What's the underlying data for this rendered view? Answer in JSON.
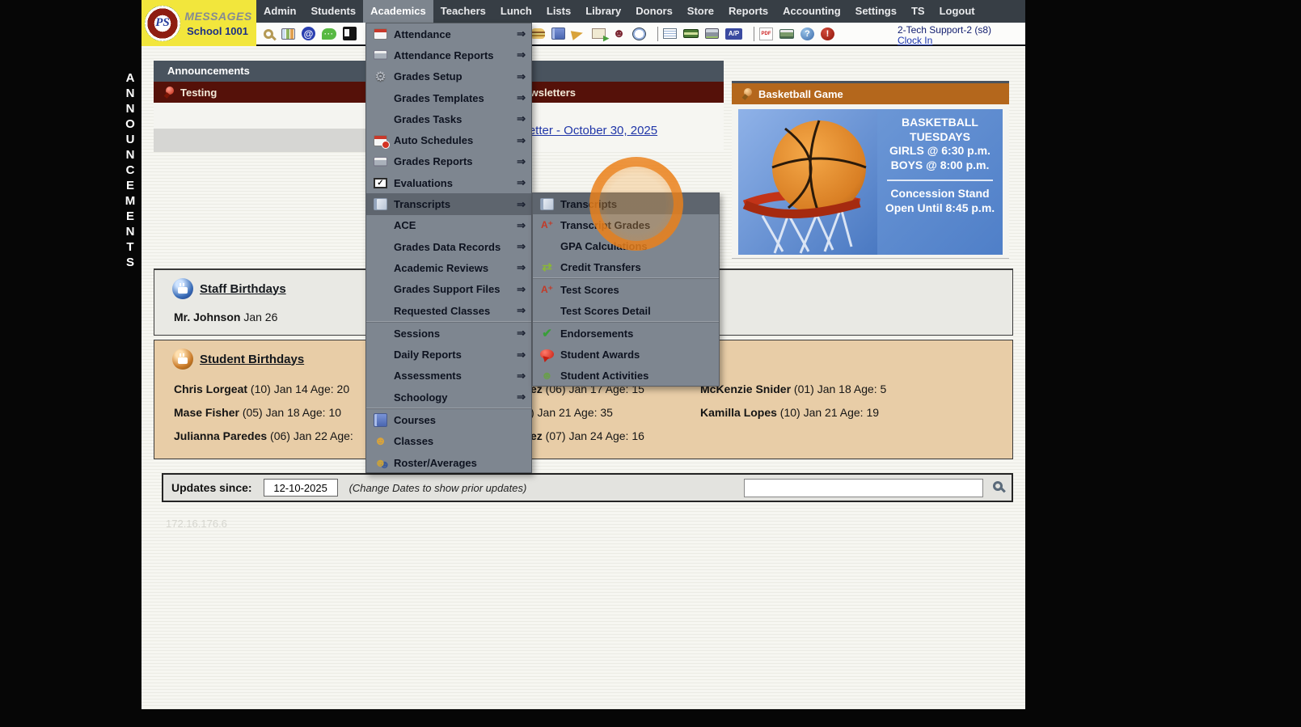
{
  "brand": {
    "name": "MESSAGES",
    "school": "School 1001",
    "monogram": "PS"
  },
  "nav": {
    "items": [
      "Admin",
      "Students",
      "Academics",
      "Teachers",
      "Lunch",
      "Lists",
      "Library",
      "Donors",
      "Store",
      "Reports",
      "Accounting",
      "Settings",
      "TS",
      "Logout"
    ],
    "active": "Academics"
  },
  "toolbar": {
    "user_label": "2-Tech Support-2 (s8)",
    "clock_in": "Clock In",
    "icons": [
      {
        "name": "search-icon",
        "cls": "i-search",
        "lens": true
      },
      {
        "name": "calendar-icon",
        "cls": "i-cal"
      },
      {
        "name": "email-icon",
        "cls": "i-at",
        "ch": "@"
      },
      {
        "name": "chat-icon",
        "cls": "i-chat",
        "ch": "···"
      },
      {
        "name": "mobile-icon",
        "cls": "i-mobile"
      },
      {
        "name": "speaker-icon",
        "cls": "i-speaker",
        "ch": "◀"
      },
      {
        "name": "toolbar-gap",
        "cls": "tb-gap",
        "deco": true
      },
      {
        "name": "lunch-icon",
        "cls": "i-lunch"
      },
      {
        "name": "binder-icon",
        "cls": "i-binder"
      },
      {
        "name": "horn-icon",
        "cls": "i-horn"
      },
      {
        "name": "send-note-icon",
        "cls": "i-send"
      },
      {
        "name": "staff-icon",
        "cls": "i-staff",
        "ch": "☻"
      },
      {
        "name": "clock-icon",
        "cls": "i-clock"
      },
      {
        "name": "toolbar-divider",
        "cls": "tb-divider",
        "deco": true
      },
      {
        "name": "spreadsheet-icon",
        "cls": "i-sheet"
      },
      {
        "name": "payment-icon",
        "cls": "i-pay"
      },
      {
        "name": "print-payment-icon",
        "cls": "i-printpay"
      },
      {
        "name": "ap-icon",
        "cls": "i-ap",
        "ch": "A/P"
      },
      {
        "name": "toolbar-divider",
        "cls": "tb-divider",
        "deco": true
      },
      {
        "name": "pdf-icon",
        "cls": "i-pdf",
        "ch": "PDF"
      },
      {
        "name": "scanner-icon",
        "cls": "i-scan"
      },
      {
        "name": "help-icon",
        "cls": "i-help",
        "ch": "?"
      },
      {
        "name": "alert-icon",
        "cls": "i-alert",
        "ch": "!"
      }
    ]
  },
  "left_rail": {
    "text": "ANNOUNCEMENTS"
  },
  "announcements": {
    "section_title": "Announcements",
    "testing": {
      "title": "Testing"
    },
    "newsletters": {
      "title": "Newsletters",
      "link": "Newsletter - October 30, 2025"
    },
    "basketball": {
      "title": "Basketball Game",
      "lines": [
        "BASKETBALL",
        "TUESDAYS",
        "GIRLS @ 6:30 p.m.",
        "BOYS  @ 8:00 p.m."
      ],
      "footer_lines": [
        "Concession Stand",
        "Open Until 8:45 p.m."
      ]
    }
  },
  "staff_birthdays": {
    "title": "Staff Birthdays",
    "entries": [
      {
        "b": "Mr. Johnson",
        "r": " Jan 26"
      }
    ]
  },
  "student_birthdays": {
    "title": "Student Birthdays",
    "columns": [
      [
        {
          "b": "Chris Lorgeat",
          "r": " (10) Jan 14 Age: 20"
        },
        {
          "b": "Mase Fisher",
          "r": " (05) Jan 18 Age: 10"
        },
        {
          "b": "Julianna Paredes",
          "r": " (06) Jan 22 Age:"
        }
      ],
      [
        {
          "b": "ez",
          "r": " (06) Jan 17 Age: 15"
        },
        {
          "b": "",
          "r": ") Jan 21 Age: 35"
        },
        {
          "b": "ez",
          "r": " (07) Jan 24 Age: 16"
        }
      ],
      [
        {
          "b": "McKenzie Snider",
          "r": " (01) Jan 18 Age: 5"
        },
        {
          "b": "Kamilla Lopes",
          "r": " (10) Jan 21 Age: 19"
        }
      ]
    ]
  },
  "updates": {
    "label": "Updates since:",
    "date": "12-10-2025",
    "hint": "(Change Dates to show prior updates)",
    "search_value": ""
  },
  "watermark": "172.16.176.6",
  "academics_menu": {
    "arrow_ch": "⇒",
    "items": [
      {
        "label": "Attendance",
        "icon": "ic-cal",
        "arrow": true
      },
      {
        "label": "Attendance Reports",
        "icon": "ic-print",
        "arrow": true
      },
      {
        "label": "Grades Setup",
        "icon": "ic-gear",
        "ch": "⚙",
        "arrow": true
      },
      {
        "label": "Grades Templates",
        "arrow": true
      },
      {
        "label": "Grades Tasks",
        "arrow": true
      },
      {
        "label": "Auto Schedules",
        "icon": "ic-calclock",
        "arrow": true
      },
      {
        "label": "Grades Reports",
        "icon": "ic-print",
        "arrow": true
      },
      {
        "label": "Evaluations",
        "icon": "ic-checkbox",
        "ch": "✓",
        "arrow": true
      },
      {
        "label": "Transcripts",
        "icon": "ic-scroll",
        "arrow": true,
        "hl": true
      },
      {
        "label": "ACE",
        "arrow": true
      },
      {
        "label": "Grades Data Records",
        "arrow": true
      },
      {
        "label": "Academic Reviews",
        "arrow": true
      },
      {
        "label": "Grades Support Files",
        "arrow": true
      },
      {
        "label": "Requested Classes",
        "arrow": true
      },
      {
        "sep": true
      },
      {
        "label": "Sessions",
        "arrow": true
      },
      {
        "label": "Daily Reports",
        "arrow": true
      },
      {
        "label": "Assessments",
        "arrow": true
      },
      {
        "label": "Schoology",
        "arrow": true
      },
      {
        "sep": true
      },
      {
        "label": "Courses",
        "icon": "ic-book"
      },
      {
        "label": "Classes",
        "icon": "ic-person",
        "ch": "☻"
      },
      {
        "label": "Roster/Averages",
        "icon": "ic-people",
        "ch": "☻"
      }
    ]
  },
  "transcripts_submenu": {
    "items": [
      {
        "label": "Transcripts",
        "icon": "ic-scroll",
        "hl": true
      },
      {
        "label": "Transcript Grades",
        "icon": "ic-aplus",
        "ch": "A⁺"
      },
      {
        "label": "GPA Calculations"
      },
      {
        "label": "Credit Transfers",
        "icon": "ic-shuffle",
        "ch": "⇄"
      },
      {
        "sep": true
      },
      {
        "label": "Test Scores",
        "icon": "ic-aplus",
        "ch": "A⁺"
      },
      {
        "label": "Test Scores Detail"
      },
      {
        "sep": true
      },
      {
        "label": "Endorsements",
        "icon": "ic-checkgreen",
        "ch": "✔"
      },
      {
        "label": "Student Awards",
        "icon": "ic-award"
      },
      {
        "label": "Student Activities",
        "icon": "ic-student",
        "ch": "☻"
      }
    ]
  }
}
